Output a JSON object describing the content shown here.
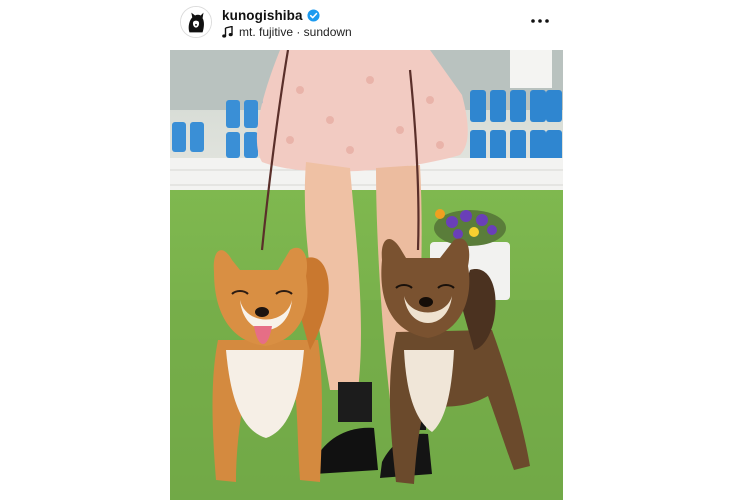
{
  "post": {
    "username": "kunogishiba",
    "verified": true,
    "audio_label": "mt. fujitive · sundown",
    "icons": {
      "avatar": "shiba-avatar",
      "verified": "verified-badge-icon",
      "music": "music-note-icon",
      "more": "more-options-icon"
    },
    "colors": {
      "verified_blue": "#1d9bf0",
      "text": "#111111"
    }
  }
}
